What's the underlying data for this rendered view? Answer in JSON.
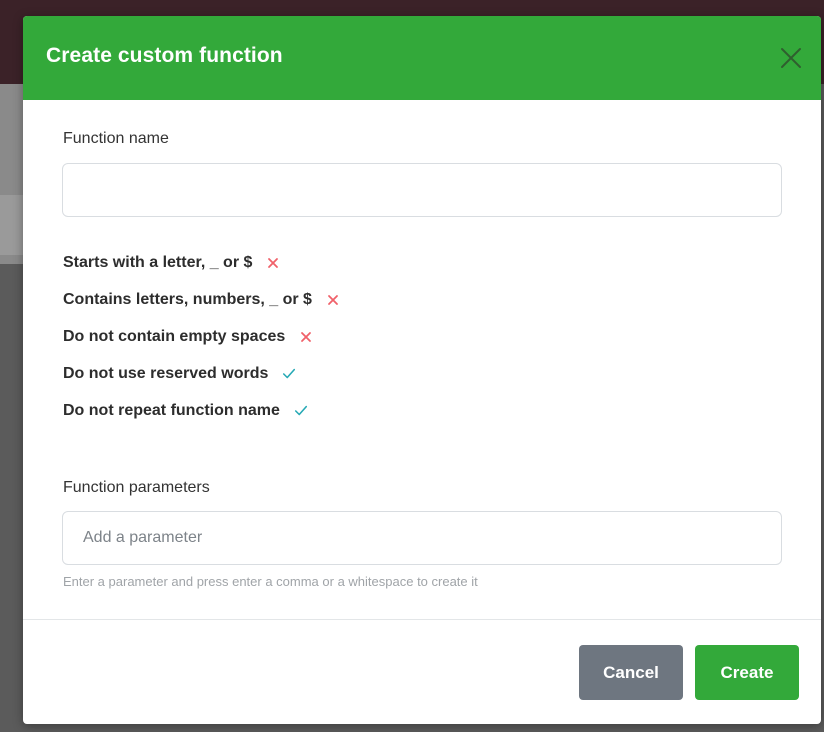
{
  "modal": {
    "title": "Create custom function",
    "close_icon": "close-icon"
  },
  "function_name": {
    "label": "Function name",
    "value": "",
    "placeholder": ""
  },
  "rules": [
    {
      "text": "Starts with a letter, _ or $",
      "status": "fail"
    },
    {
      "text": "Contains letters, numbers, _ or $",
      "status": "fail"
    },
    {
      "text": "Do not contain empty spaces",
      "status": "fail"
    },
    {
      "text": "Do not use reserved words",
      "status": "pass"
    },
    {
      "text": "Do not repeat function name",
      "status": "pass"
    }
  ],
  "function_parameters": {
    "label": "Function parameters",
    "placeholder": "Add a parameter",
    "hint": "Enter a parameter and press enter a comma or a whitespace to create it"
  },
  "footer": {
    "cancel_label": "Cancel",
    "create_label": "Create"
  },
  "colors": {
    "header": "#33a93a",
    "create_button": "#33a93a",
    "cancel_button": "#6e7680",
    "fail_icon": "#f0616a",
    "pass_icon": "#26a9b5"
  }
}
